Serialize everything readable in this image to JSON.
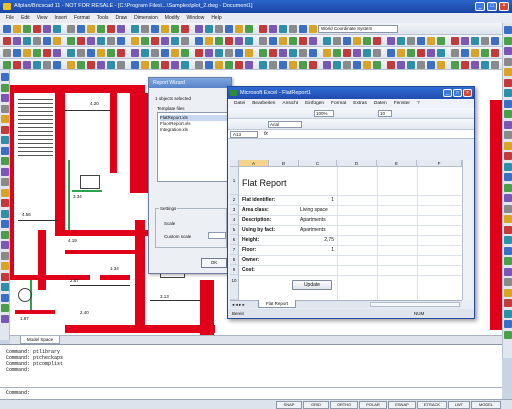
{
  "app": {
    "title": "Allplan/Bricscad 11 - NOT FOR RESALE - [C:\\Program Files\\...\\Samples\\plot_2.dwg - Document1]"
  },
  "menu": [
    "File",
    "Edit",
    "View",
    "Insert",
    "Format",
    "Tools",
    "Draw",
    "Dimension",
    "Modify",
    "Window",
    "Help"
  ],
  "toolbar": {
    "ucs_select": "World Coordinate System"
  },
  "report_dialog": {
    "title": "Report Wizard",
    "objects_selected": "1 objects selected",
    "templates_label": "Template files",
    "templates": [
      "FlatReport.xls",
      "FloorReport.xls",
      "Integration.xls"
    ],
    "settings_label": "Settings",
    "scale_label": "Scale",
    "custom_scale_label": "Custom scale",
    "ok_label": "OK"
  },
  "excel": {
    "title": "Microsoft Excel - FlatReport1",
    "menu": [
      "Datei",
      "Bearbeiten",
      "Ansicht",
      "Einfügen",
      "Format",
      "Extras",
      "Daten",
      "Fenster",
      "?"
    ],
    "zoom": "100%",
    "font_name": "Arial",
    "font_size": "10",
    "name_box": "A13",
    "columns": [
      "A",
      "B",
      "C",
      "D",
      "E",
      "F"
    ],
    "rows": [
      "1",
      "2",
      "3",
      "4",
      "5",
      "6",
      "7",
      "8",
      "9",
      "10"
    ],
    "report_title": "Flat Report",
    "labels": [
      "Flat identifier:",
      "Area class:",
      "Description:",
      "Using by fact:",
      "Height:",
      "Floor:",
      "Owner:",
      "Cost:"
    ],
    "values": [
      "1",
      "Living space",
      "Apartments",
      "Apartments",
      "2,75",
      "1",
      "",
      ""
    ],
    "update_button": "Update",
    "sheet_tab": "Flat Report",
    "status_left": "Bereit",
    "status_right": "NUM"
  },
  "drawing": {
    "model_tab": "Model Space",
    "dims": [
      "4.20",
      "3.34",
      "4.19",
      "4.56",
      "2.87",
      "3.13",
      "1.34",
      "1.87",
      "2.40"
    ]
  },
  "command": {
    "lines": [
      "Command: ptlibrary",
      "Command: ptcheckaps",
      "Command: ptcomplist",
      "Command:"
    ],
    "prompt": "Command:"
  },
  "status": {
    "buttons": [
      "SNAP",
      "GRID",
      "ORTHO",
      "POLAR",
      "ESNAP",
      "ETRACK",
      "LWT",
      "MODEL"
    ]
  }
}
